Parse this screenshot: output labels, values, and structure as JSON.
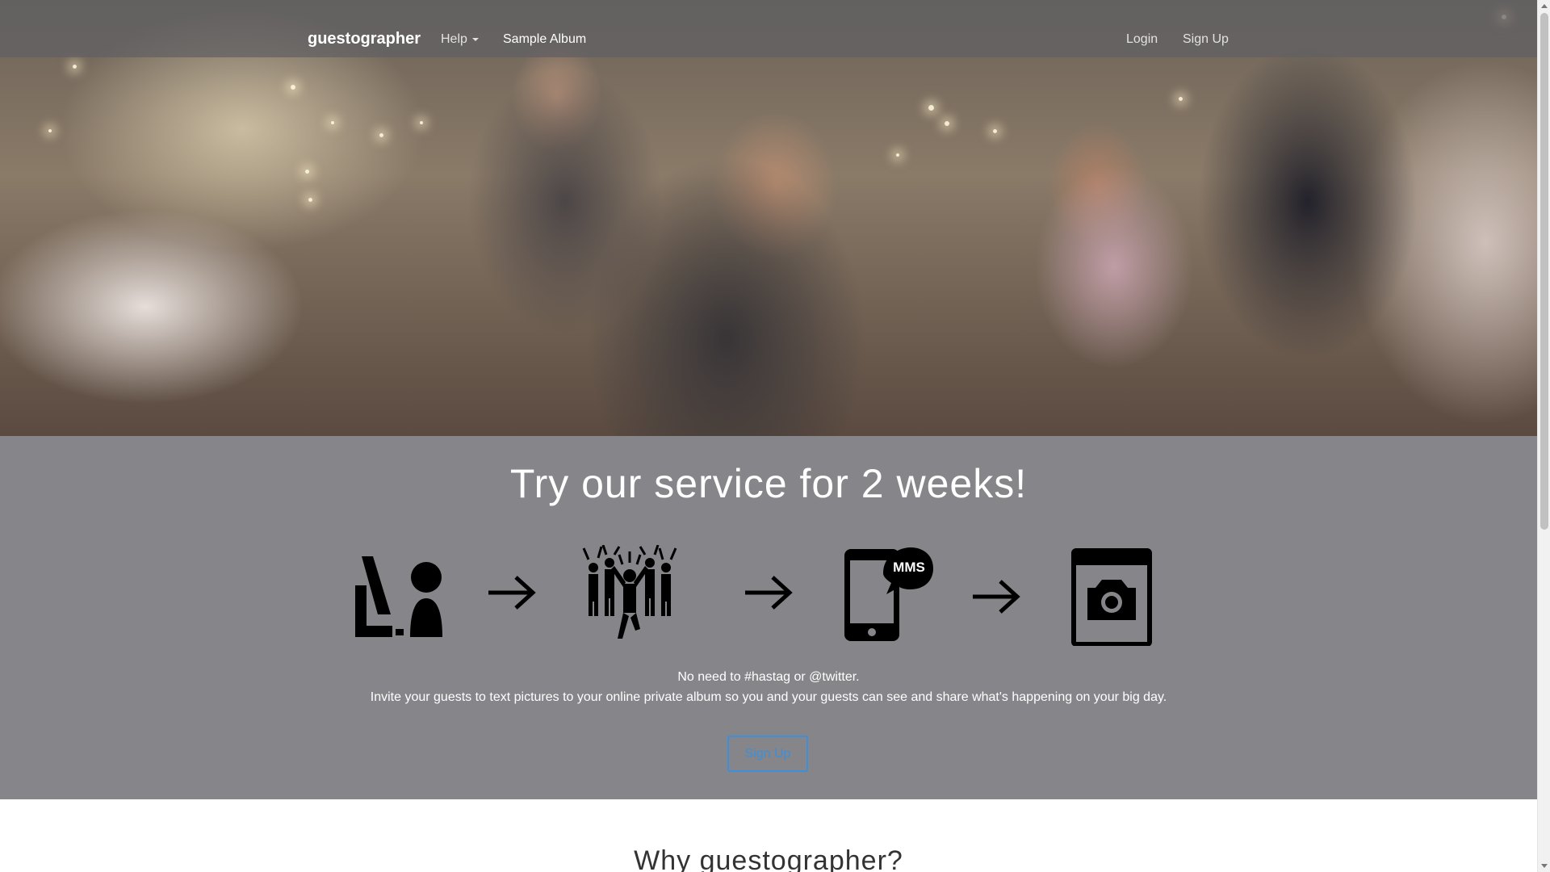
{
  "navbar": {
    "brand": "guestographer",
    "help_label": "Help",
    "sample_album_label": "Sample Album",
    "login_label": "Login",
    "signup_label": "Sign Up"
  },
  "band": {
    "heading": "Try our service for 2 weeks!",
    "steps": [
      {
        "icon": "signup-people-icon"
      },
      {
        "icon": "party-crowd-icon"
      },
      {
        "icon": "phone-mms-icon",
        "badge": "MMS"
      },
      {
        "icon": "photo-album-icon"
      }
    ],
    "line1": "No need to #hastag or @twitter.",
    "line2": "Invite your guests to text pictures to your online private album so you and your guests can see and share what's happening on your big day.",
    "cta_label": "Sign Up"
  },
  "why": {
    "heading": "Why guestographer?"
  },
  "colors": {
    "band_bg": "#86858a",
    "cta": "#3d8fd9"
  }
}
